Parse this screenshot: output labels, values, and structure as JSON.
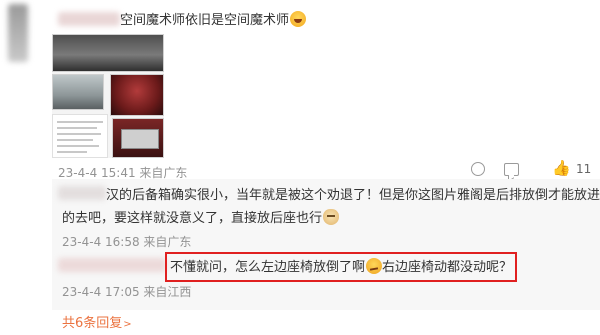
{
  "comment": {
    "text": "空间魔术师依旧是空间魔术师",
    "meta": "23-4-4 15:41 来自广东",
    "like_count": "11",
    "emoji": "laugh-emoji"
  },
  "replies": [
    {
      "text_line1": "汉的后备箱确实很小，当年就是被这个劝退了！但是你这图片雅阁是后排放倒才能放进",
      "text_line2": "的去吧，要这样就没意义了，直接放后座也行",
      "meta": "23-4-4 16:58 来自广东"
    },
    {
      "text_before": "不懂就问，怎么左边座椅放倒了啊",
      "text_after": "右边座椅动都没动呢？",
      "meta": "23-4-4 17:05 来自江西",
      "highlight_color": "#e02020"
    }
  ],
  "more_replies": "共6条回复",
  "colors": {
    "link": "#eb7340",
    "meta": "#939393",
    "reply_bg": "#f7f7f7"
  }
}
